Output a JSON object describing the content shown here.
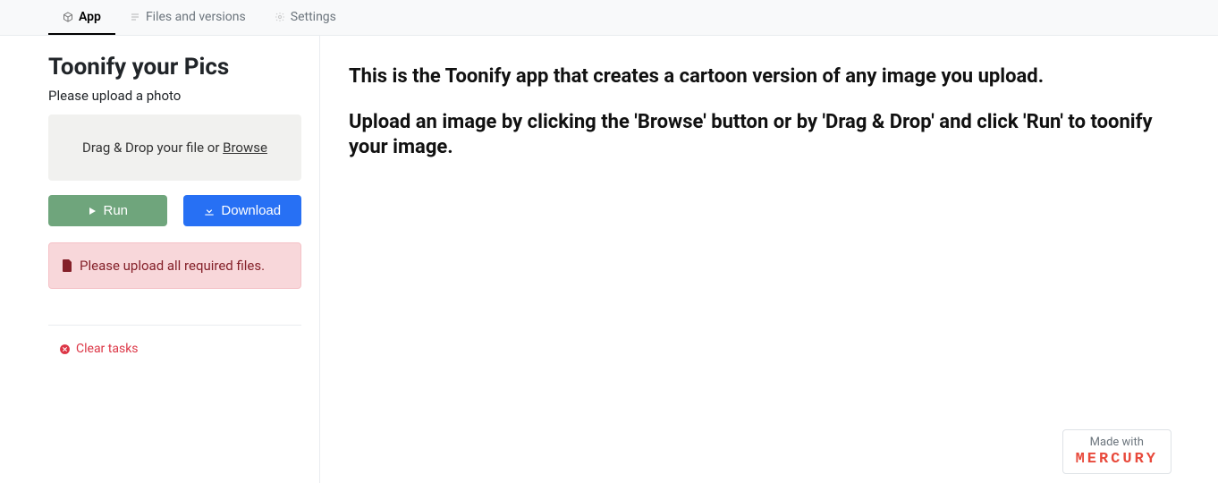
{
  "tabs": {
    "app": "App",
    "files": "Files and versions",
    "settings": "Settings"
  },
  "sidebar": {
    "title": "Toonify your Pics",
    "subtitle": "Please upload a photo",
    "dropzone_prefix": "Drag & Drop your file or ",
    "dropzone_browse": "Browse",
    "run_label": "Run",
    "download_label": "Download",
    "alert_text": "Please upload all required files.",
    "clear_tasks": "Clear tasks"
  },
  "main": {
    "para1": "This is the Toonify app that creates a cartoon version of any image you upload.",
    "para2": "Upload an image by clicking the 'Browse' button or by 'Drag & Drop' and click 'Run' to toonify your image."
  },
  "footer": {
    "made_with": "Made with",
    "brand": "MERCURY"
  }
}
